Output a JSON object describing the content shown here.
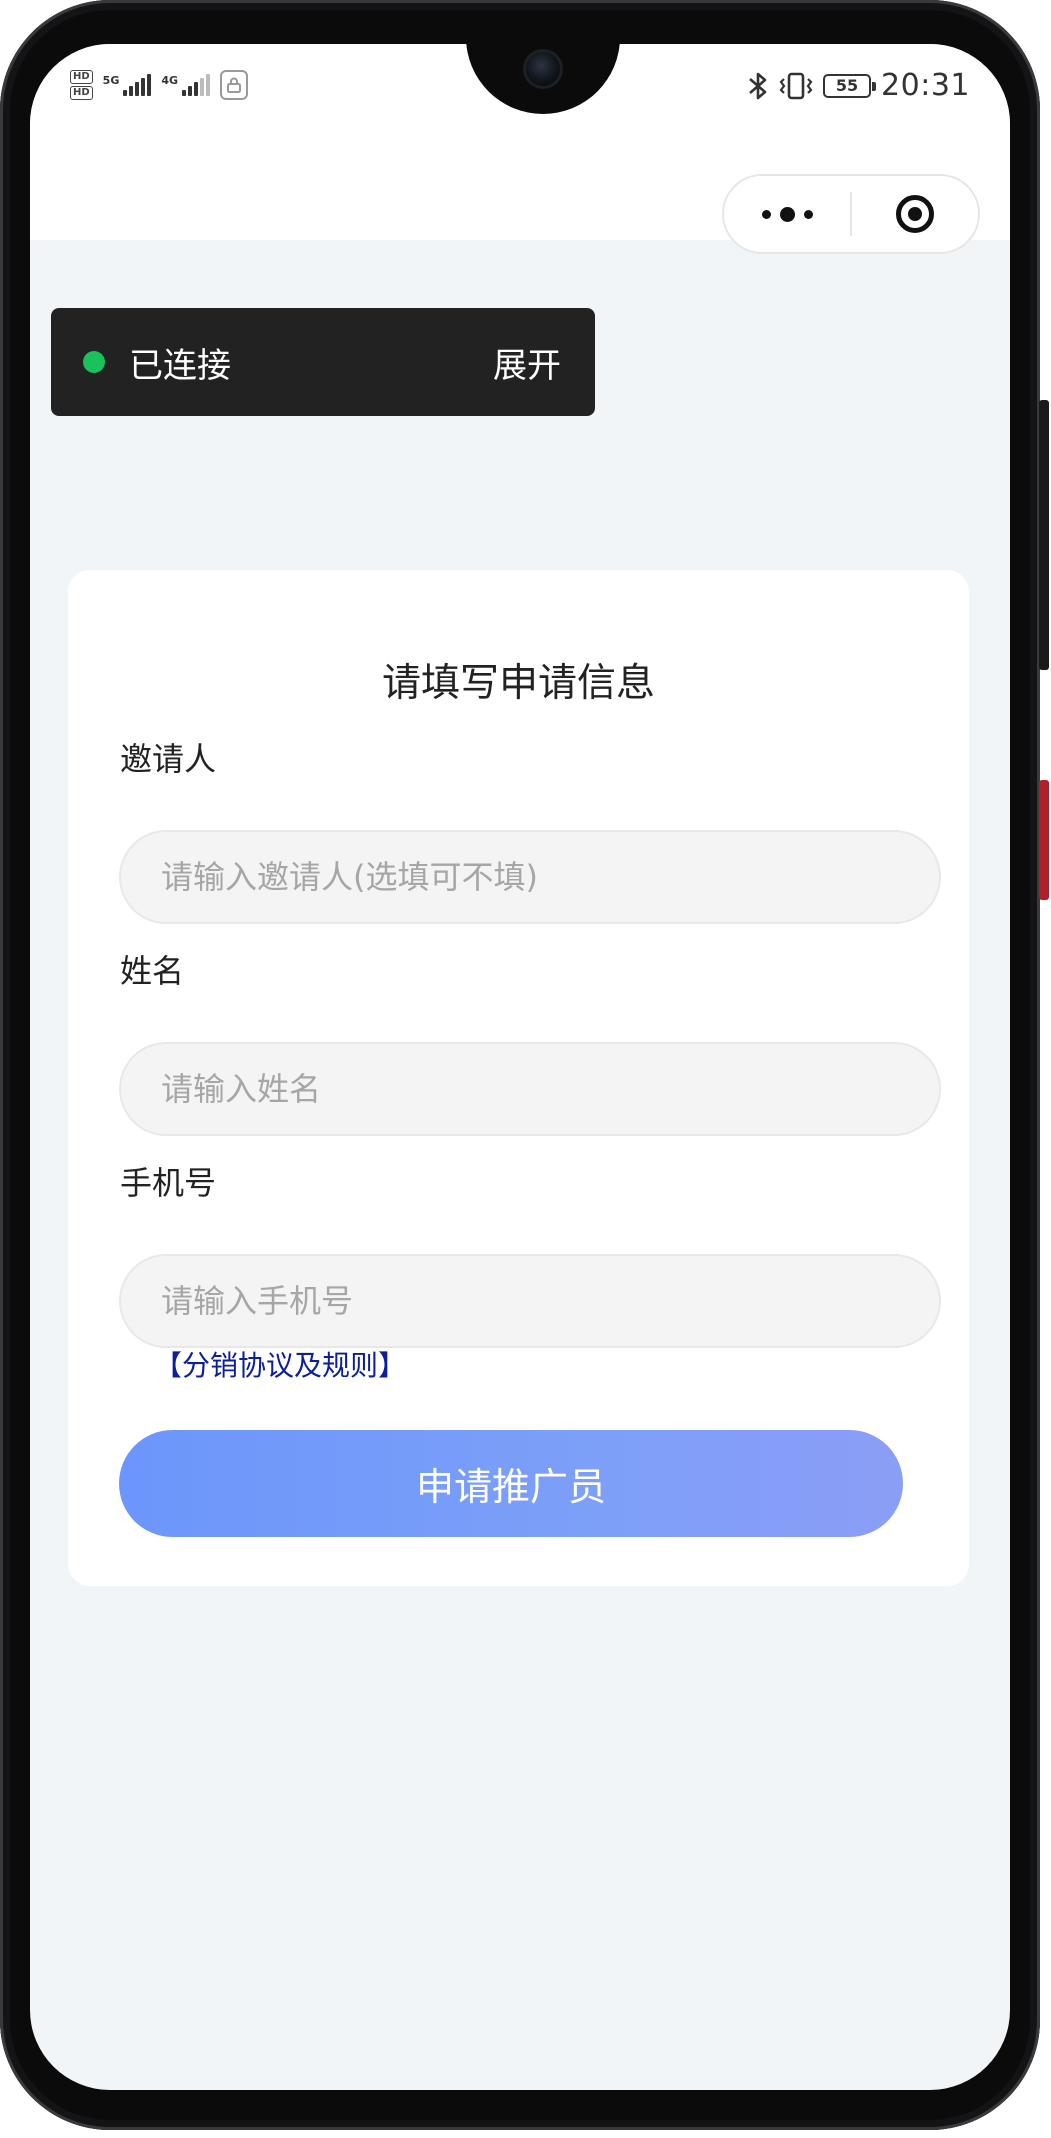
{
  "status_bar": {
    "network_left": "5G",
    "network_right": "4G",
    "battery": "55",
    "time": "20:31",
    "icons": [
      "hd-icon",
      "signal-icon",
      "lock-icon",
      "bluetooth-icon",
      "vibrate-icon",
      "battery-icon"
    ]
  },
  "capsule": {
    "more_icon": "more-dots-icon",
    "close_icon": "target-icon"
  },
  "connection": {
    "status": "已连接",
    "toggle": "展开",
    "status_color": "#19c25a"
  },
  "form": {
    "title": "请填写申请信息",
    "inviter": {
      "label": "邀请人",
      "placeholder": "请输入邀请人(选填可不填)",
      "value": ""
    },
    "name": {
      "label": "姓名",
      "placeholder": "请输入姓名",
      "value": ""
    },
    "phone": {
      "label": "手机号",
      "placeholder": "请输入手机号",
      "value": ""
    },
    "agreement": "【分销协议及规则】",
    "submit": "申请推广员"
  },
  "colors": {
    "accent": "#6b96fb",
    "link": "#0b1f9a",
    "page_background": "#f2f5f8"
  }
}
